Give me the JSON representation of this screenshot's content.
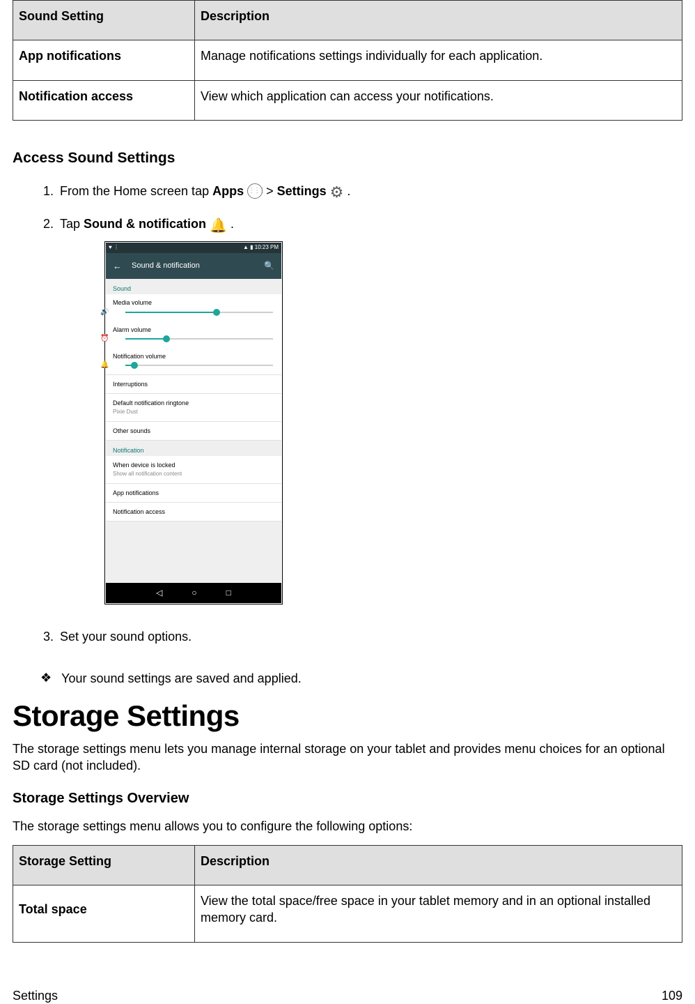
{
  "sound_table": {
    "headers": [
      "Sound Setting",
      "Description"
    ],
    "rows": [
      {
        "label": "App notifications",
        "desc": "Manage notifications settings individually for each application."
      },
      {
        "label": "Notification access",
        "desc": "View which application can access your notifications."
      }
    ]
  },
  "access_heading": "Access Sound Settings",
  "steps": {
    "s1a": "From the Home screen tap ",
    "s1b_apps": "Apps",
    "s1c": " > ",
    "s1d_settings": "Settings",
    "s1e": " .",
    "s2a": "Tap ",
    "s2b": "Sound & notification",
    "s2c": " .",
    "s3": "Set your sound options."
  },
  "result_line": "Your sound settings are saved and applied.",
  "storage_heading": "Storage Settings",
  "storage_intro": "The storage settings menu lets you manage internal storage on your tablet and provides menu choices for an optional SD card (not included).",
  "storage_overview_heading": "Storage Settings Overview",
  "storage_overview_intro": "The storage settings menu allows you to configure the following options:",
  "storage_table": {
    "headers": [
      "Storage Setting",
      "Description"
    ],
    "rows": [
      {
        "label": "Total space",
        "desc": "View the total space/free space in your tablet memory and in an optional installed memory card."
      }
    ]
  },
  "footer_left": "Settings",
  "footer_right": "109",
  "screenshot": {
    "status_left": "♥ ⋮",
    "status_right": "▲ ▮ 10:23 PM",
    "header_title": "Sound & notification",
    "sections": {
      "sound": "Sound",
      "notification": "Notification"
    },
    "items": {
      "media_volume": "Media volume",
      "alarm_volume": "Alarm volume",
      "notif_volume": "Notification volume",
      "interruptions": "Interruptions",
      "default_ring": "Default notification ringtone",
      "default_ring_sub": "Pixie Dust",
      "other_sounds": "Other sounds",
      "when_locked": "When device is locked",
      "when_locked_sub": "Show all notification content",
      "app_notifications": "App notifications",
      "notification_access": "Notification access"
    }
  }
}
